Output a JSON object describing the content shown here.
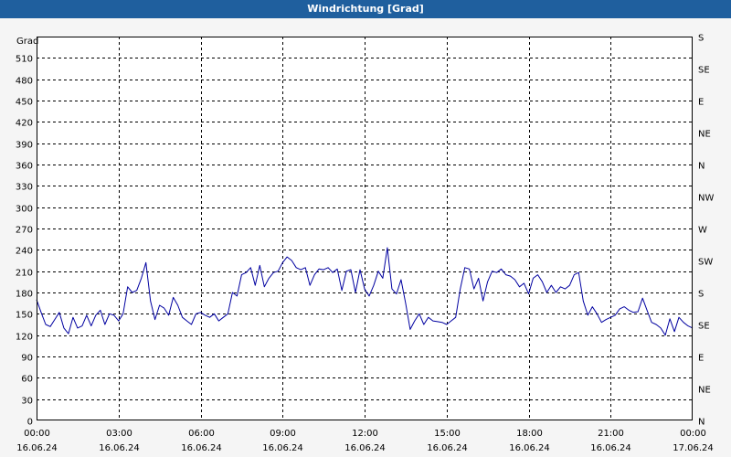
{
  "window": {
    "title": "Windrichtung [Grad]"
  },
  "chart_data": {
    "type": "line",
    "title": "Windrichtung [Grad]",
    "ylabel": "Grad",
    "ylim": [
      0,
      540
    ],
    "yticks": [
      0,
      30,
      60,
      90,
      120,
      150,
      180,
      210,
      240,
      270,
      300,
      330,
      360,
      390,
      420,
      450,
      480,
      510
    ],
    "right_ticks": [
      "N",
      "NE",
      "E",
      "SE",
      "S",
      "SW",
      "W",
      "NW",
      "N",
      "NE",
      "E",
      "SE",
      "S"
    ],
    "xticks": [
      {
        "time": "00:00",
        "date": "16.06.24"
      },
      {
        "time": "03:00",
        "date": "16.06.24"
      },
      {
        "time": "06:00",
        "date": "16.06.24"
      },
      {
        "time": "09:00",
        "date": "16.06.24"
      },
      {
        "time": "12:00",
        "date": "16.06.24"
      },
      {
        "time": "15:00",
        "date": "16.06.24"
      },
      {
        "time": "18:00",
        "date": "16.06.24"
      },
      {
        "time": "21:00",
        "date": "16.06.24"
      },
      {
        "time": "00:00",
        "date": "17.06.24"
      }
    ],
    "grid": true,
    "series": [
      {
        "color": "#0000a0",
        "x": [
          "00:00",
          "00:10",
          "00:20",
          "00:30",
          "00:40",
          "00:50",
          "01:00",
          "01:10",
          "01:20",
          "01:30",
          "01:40",
          "01:50",
          "02:00",
          "02:10",
          "02:20",
          "02:30",
          "02:40",
          "02:50",
          "03:00",
          "03:10",
          "03:20",
          "03:30",
          "03:40",
          "03:50",
          "04:00",
          "04:10",
          "04:20",
          "04:30",
          "04:40",
          "04:50",
          "05:00",
          "05:10",
          "05:20",
          "05:30",
          "05:40",
          "05:50",
          "06:00",
          "06:10",
          "06:20",
          "06:30",
          "06:40",
          "06:50",
          "07:00",
          "07:10",
          "07:20",
          "07:30",
          "07:40",
          "07:50",
          "08:00",
          "08:10",
          "08:20",
          "08:30",
          "08:40",
          "08:50",
          "09:00",
          "09:10",
          "09:20",
          "09:30",
          "09:40",
          "09:50",
          "10:00",
          "10:10",
          "10:20",
          "10:30",
          "10:40",
          "10:50",
          "11:00",
          "11:10",
          "11:20",
          "11:30",
          "11:40",
          "11:50",
          "12:00",
          "12:10",
          "12:20",
          "12:30",
          "12:40",
          "12:50",
          "13:00",
          "13:10",
          "13:20",
          "13:30",
          "13:40",
          "13:50",
          "14:00",
          "14:10",
          "14:20",
          "14:30",
          "14:40",
          "14:50",
          "15:00",
          "15:10",
          "15:20",
          "15:30",
          "15:40",
          "15:50",
          "16:00",
          "16:10",
          "16:20",
          "16:30",
          "16:40",
          "16:50",
          "17:00",
          "17:10",
          "17:20",
          "17:30",
          "17:40",
          "17:50",
          "18:00",
          "18:10",
          "18:20",
          "18:30",
          "18:40",
          "18:50",
          "19:00",
          "19:10",
          "19:20",
          "19:30",
          "19:40",
          "19:50",
          "20:00",
          "20:10",
          "20:20",
          "20:30",
          "20:40",
          "20:50",
          "21:00",
          "21:10",
          "21:20",
          "21:30",
          "21:40",
          "21:50",
          "22:00",
          "22:10",
          "22:20",
          "22:30",
          "22:40",
          "22:50",
          "23:00",
          "23:10",
          "23:20",
          "23:30",
          "23:40",
          "23:50",
          "24:00"
        ],
        "values": [
          170,
          152,
          135,
          132,
          142,
          152,
          130,
          122,
          145,
          130,
          133,
          148,
          133,
          148,
          155,
          135,
          150,
          148,
          140,
          150,
          188,
          180,
          183,
          200,
          222,
          168,
          142,
          162,
          158,
          148,
          173,
          162,
          145,
          140,
          135,
          150,
          152,
          148,
          145,
          150,
          140,
          145,
          150,
          180,
          175,
          205,
          208,
          215,
          190,
          218,
          188,
          200,
          208,
          210,
          222,
          230,
          225,
          215,
          212,
          215,
          190,
          205,
          213,
          212,
          215,
          208,
          213,
          183,
          210,
          212,
          180,
          212,
          185,
          175,
          190,
          210,
          200,
          243,
          185,
          178,
          198,
          165,
          128,
          140,
          150,
          135,
          145,
          140,
          139,
          138,
          135,
          140,
          145,
          185,
          215,
          213,
          185,
          200,
          168,
          195,
          210,
          208,
          213,
          205,
          203,
          198,
          188,
          193,
          178,
          200,
          205,
          195,
          180,
          190,
          180,
          188,
          185,
          190,
          205,
          208,
          168,
          148,
          160,
          150,
          138,
          142,
          145,
          148,
          157,
          160,
          155,
          152,
          153,
          172,
          155,
          138,
          135,
          130,
          120,
          143,
          125,
          145,
          138,
          133,
          130
        ]
      }
    ]
  }
}
